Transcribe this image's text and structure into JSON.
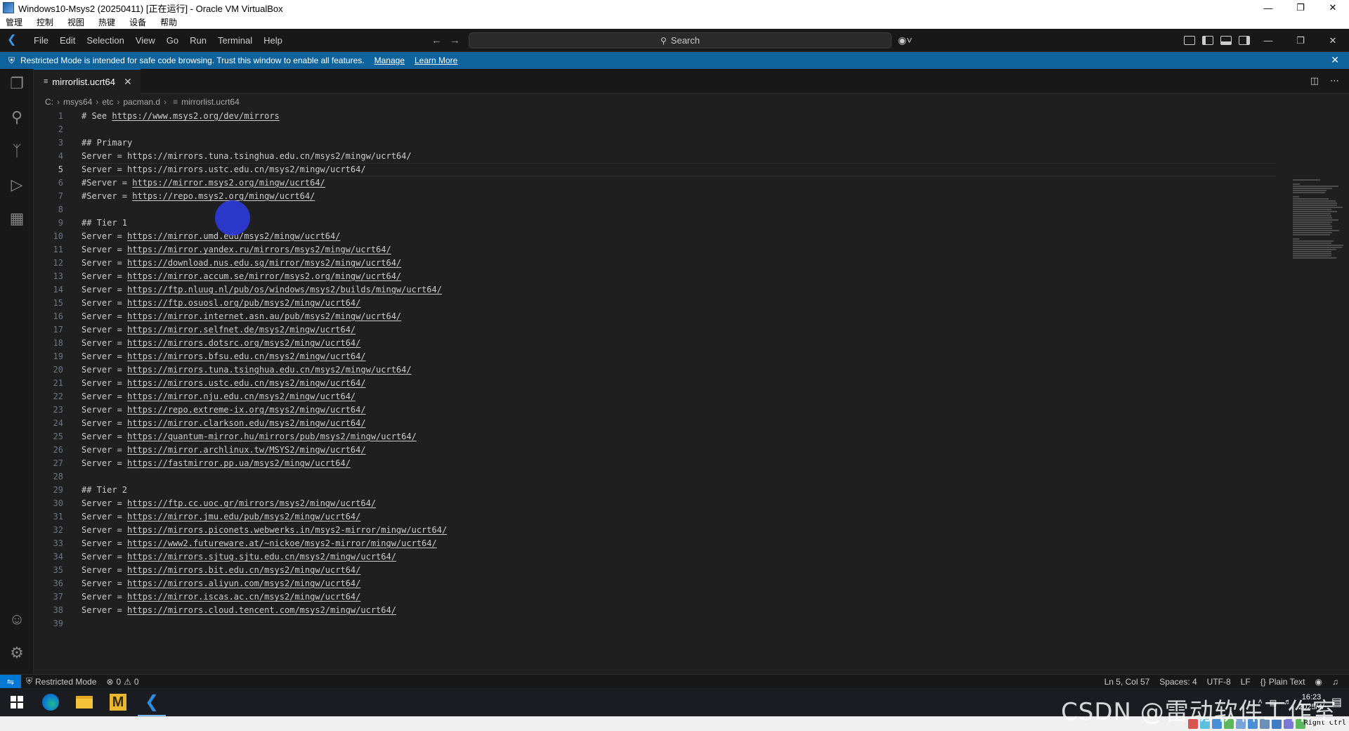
{
  "vbox": {
    "window_title": "Windows10-Msys2 (20250411) [正在运行] - Oracle VM VirtualBox",
    "menu": [
      "管理",
      "控制",
      "视图",
      "热键",
      "设备",
      "帮助"
    ],
    "host_key": "Right Ctrl"
  },
  "vscode": {
    "menu": [
      "File",
      "Edit",
      "Selection",
      "View",
      "Go",
      "Run",
      "Terminal",
      "Help"
    ],
    "search_label": "Search",
    "banner": {
      "text": "Restricted Mode is intended for safe code browsing. Trust this window to enable all features.",
      "manage": "Manage",
      "learn_more": "Learn More"
    },
    "tab": {
      "label": "mirrorlist.ucrt64"
    },
    "breadcrumb": [
      "C:",
      "msys64",
      "etc",
      "pacman.d",
      "mirrorlist.ucrt64"
    ],
    "current_line": 5,
    "lines": [
      {
        "n": "1",
        "pre": "# See ",
        "url": "https://www.msys2.org/dev/mirrors"
      },
      {
        "n": "2",
        "pre": "",
        "url": ""
      },
      {
        "n": "3",
        "pre": "## Primary",
        "url": ""
      },
      {
        "n": "4",
        "pre": "Server = https://mirrors.tuna.tsinghua.edu.cn/msys2/mingw/ucrt64/",
        "url": ""
      },
      {
        "n": "5",
        "pre": "Server = https://mirrors.ustc.edu.cn/msys2/mingw/ucrt64/",
        "url": ""
      },
      {
        "n": "6",
        "pre": "#Server = ",
        "url": "https://mirror.msys2.org/mingw/ucrt64/"
      },
      {
        "n": "7",
        "pre": "#Server = ",
        "url": "https://repo.msys2.org/mingw/ucrt64/"
      },
      {
        "n": "8",
        "pre": "",
        "url": ""
      },
      {
        "n": "9",
        "pre": "## Tier 1",
        "url": ""
      },
      {
        "n": "10",
        "pre": "Server = ",
        "url": "https://mirror.umd.edu/msys2/mingw/ucrt64/"
      },
      {
        "n": "11",
        "pre": "Server = ",
        "url": "https://mirror.yandex.ru/mirrors/msys2/mingw/ucrt64/"
      },
      {
        "n": "12",
        "pre": "Server = ",
        "url": "https://download.nus.edu.sg/mirror/msys2/mingw/ucrt64/"
      },
      {
        "n": "13",
        "pre": "Server = ",
        "url": "https://mirror.accum.se/mirror/msys2.org/mingw/ucrt64/"
      },
      {
        "n": "14",
        "pre": "Server = ",
        "url": "https://ftp.nluug.nl/pub/os/windows/msys2/builds/mingw/ucrt64/"
      },
      {
        "n": "15",
        "pre": "Server = ",
        "url": "https://ftp.osuosl.org/pub/msys2/mingw/ucrt64/"
      },
      {
        "n": "16",
        "pre": "Server = ",
        "url": "https://mirror.internet.asn.au/pub/msys2/mingw/ucrt64/"
      },
      {
        "n": "17",
        "pre": "Server = ",
        "url": "https://mirror.selfnet.de/msys2/mingw/ucrt64/"
      },
      {
        "n": "18",
        "pre": "Server = ",
        "url": "https://mirrors.dotsrc.org/msys2/mingw/ucrt64/"
      },
      {
        "n": "19",
        "pre": "Server = ",
        "url": "https://mirrors.bfsu.edu.cn/msys2/mingw/ucrt64/"
      },
      {
        "n": "20",
        "pre": "Server = ",
        "url": "https://mirrors.tuna.tsinghua.edu.cn/msys2/mingw/ucrt64/"
      },
      {
        "n": "21",
        "pre": "Server = ",
        "url": "https://mirrors.ustc.edu.cn/msys2/mingw/ucrt64/"
      },
      {
        "n": "22",
        "pre": "Server = ",
        "url": "https://mirror.nju.edu.cn/msys2/mingw/ucrt64/"
      },
      {
        "n": "23",
        "pre": "Server = ",
        "url": "https://repo.extreme-ix.org/msys2/mingw/ucrt64/"
      },
      {
        "n": "24",
        "pre": "Server = ",
        "url": "https://mirror.clarkson.edu/msys2/mingw/ucrt64/"
      },
      {
        "n": "25",
        "pre": "Server = ",
        "url": "https://quantum-mirror.hu/mirrors/pub/msys2/mingw/ucrt64/"
      },
      {
        "n": "26",
        "pre": "Server = ",
        "url": "https://mirror.archlinux.tw/MSYS2/mingw/ucrt64/"
      },
      {
        "n": "27",
        "pre": "Server = ",
        "url": "https://fastmirror.pp.ua/msys2/mingw/ucrt64/"
      },
      {
        "n": "28",
        "pre": "",
        "url": ""
      },
      {
        "n": "29",
        "pre": "## Tier 2",
        "url": ""
      },
      {
        "n": "30",
        "pre": "Server = ",
        "url": "https://ftp.cc.uoc.gr/mirrors/msys2/mingw/ucrt64/"
      },
      {
        "n": "31",
        "pre": "Server = ",
        "url": "https://mirror.jmu.edu/pub/msys2/mingw/ucrt64/"
      },
      {
        "n": "32",
        "pre": "Server = ",
        "url": "https://mirrors.piconets.webwerks.in/msys2-mirror/mingw/ucrt64/"
      },
      {
        "n": "33",
        "pre": "Server = ",
        "url": "https://www2.futureware.at/~nickoe/msys2-mirror/mingw/ucrt64/"
      },
      {
        "n": "34",
        "pre": "Server = ",
        "url": "https://mirrors.sjtug.sjtu.edu.cn/msys2/mingw/ucrt64/"
      },
      {
        "n": "35",
        "pre": "Server = ",
        "url": "https://mirrors.bit.edu.cn/msys2/mingw/ucrt64/"
      },
      {
        "n": "36",
        "pre": "Server = ",
        "url": "https://mirrors.aliyun.com/msys2/mingw/ucrt64/"
      },
      {
        "n": "37",
        "pre": "Server = ",
        "url": "https://mirror.iscas.ac.cn/msys2/mingw/ucrt64/"
      },
      {
        "n": "38",
        "pre": "Server = ",
        "url": "https://mirrors.cloud.tencent.com/msys2/mingw/ucrt64/"
      },
      {
        "n": "39",
        "pre": "",
        "url": ""
      }
    ],
    "status": {
      "restricted": "Restricted Mode",
      "errors": "0",
      "warnings": "0",
      "position": "Ln 5, Col 57",
      "spaces": "Spaces: 4",
      "encoding": "UTF-8",
      "eol": "LF",
      "language": "Plain Text"
    }
  },
  "taskbar": {
    "time": "16:23",
    "date": "2025/4/"
  },
  "watermark": "CSDN @雷动软件工作室",
  "colors": {
    "accent": "#0078d4",
    "banner": "#0e639c",
    "editor_bg": "#1f1f1f"
  }
}
